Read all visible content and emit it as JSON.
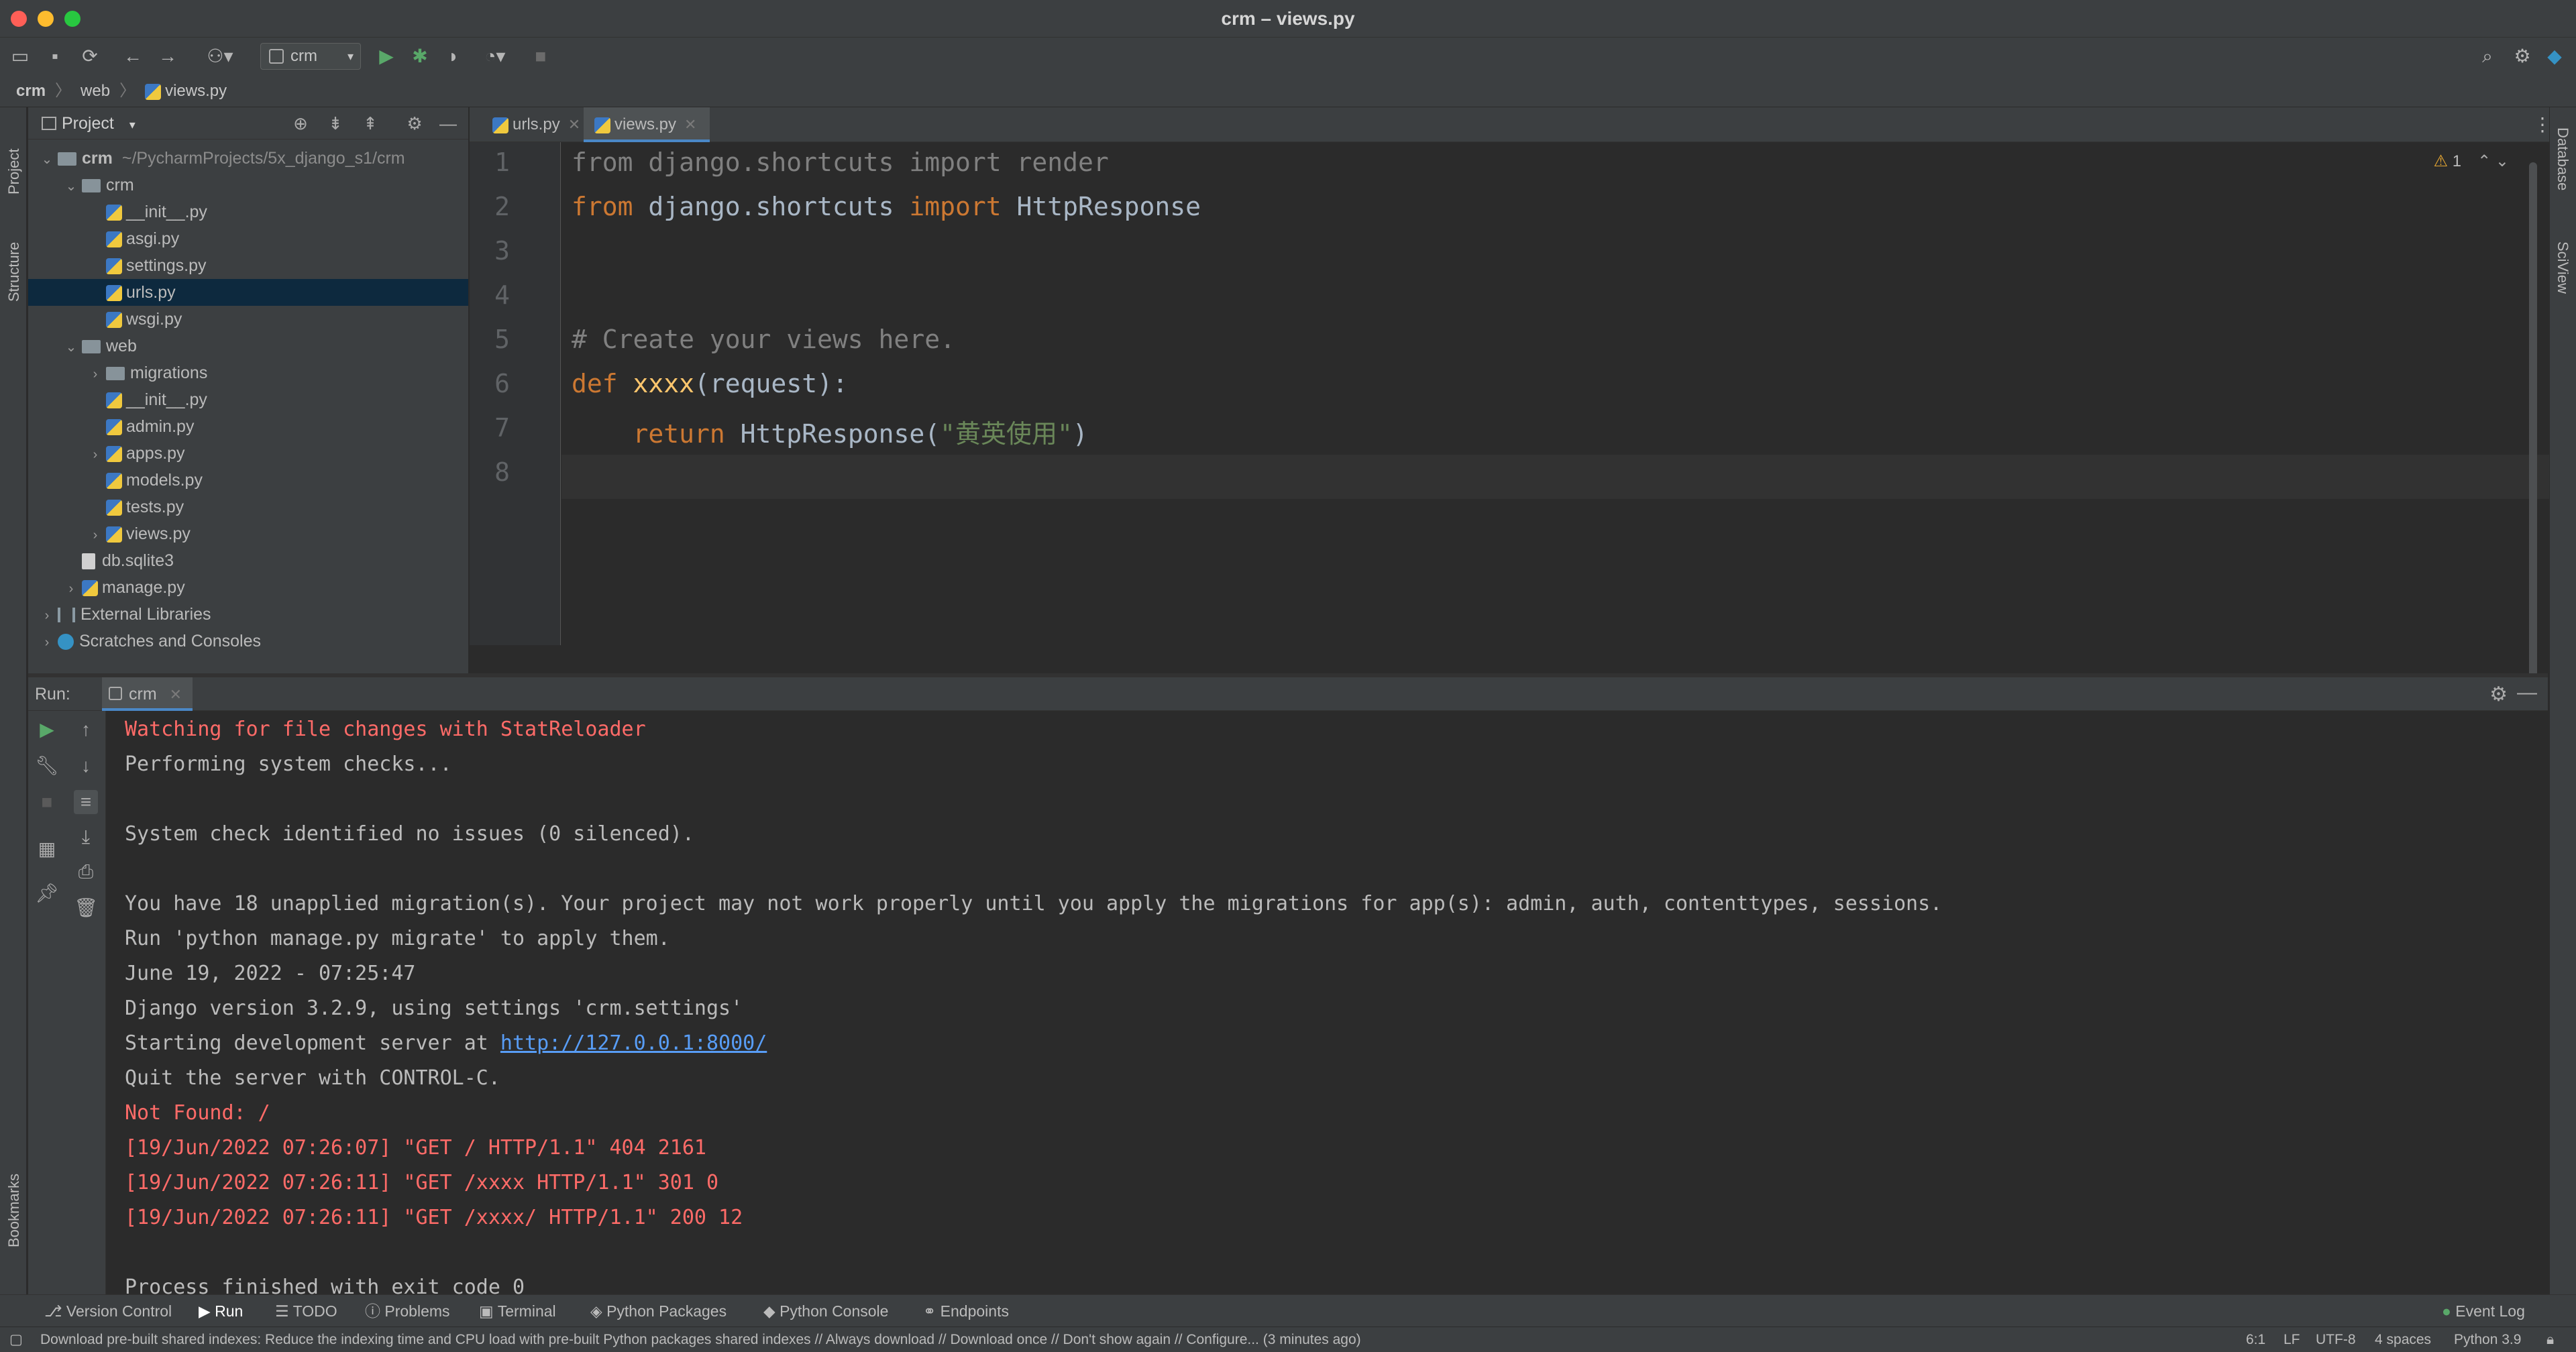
{
  "window": {
    "title": "crm – views.py"
  },
  "toolbar": {
    "run_config": "crm"
  },
  "breadcrumb": [
    "crm",
    "web",
    "views.py"
  ],
  "left_strip": [
    "Project",
    "Structure",
    "Bookmarks"
  ],
  "right_strip": [
    "Database",
    "SciView"
  ],
  "project_panel": {
    "title": "Project",
    "tree": [
      {
        "label": "crm",
        "suffix": "~/PycharmProjects/5x_django_s1/crm",
        "depth": 0,
        "type": "folder",
        "expanded": true
      },
      {
        "label": "crm",
        "depth": 1,
        "type": "folder",
        "expanded": true
      },
      {
        "label": "__init__.py",
        "depth": 2,
        "type": "py"
      },
      {
        "label": "asgi.py",
        "depth": 2,
        "type": "py"
      },
      {
        "label": "settings.py",
        "depth": 2,
        "type": "py"
      },
      {
        "label": "urls.py",
        "depth": 2,
        "type": "py",
        "selected": true
      },
      {
        "label": "wsgi.py",
        "depth": 2,
        "type": "py"
      },
      {
        "label": "web",
        "depth": 1,
        "type": "folder",
        "expanded": true
      },
      {
        "label": "migrations",
        "depth": 2,
        "type": "folder",
        "collapsed": true
      },
      {
        "label": "__init__.py",
        "depth": 2,
        "type": "py"
      },
      {
        "label": "admin.py",
        "depth": 2,
        "type": "py"
      },
      {
        "label": "apps.py",
        "depth": 2,
        "type": "py",
        "collapsed": true
      },
      {
        "label": "models.py",
        "depth": 2,
        "type": "py"
      },
      {
        "label": "tests.py",
        "depth": 2,
        "type": "py"
      },
      {
        "label": "views.py",
        "depth": 2,
        "type": "py",
        "collapsed": true
      },
      {
        "label": "db.sqlite3",
        "depth": 1,
        "type": "db"
      },
      {
        "label": "manage.py",
        "depth": 1,
        "type": "py",
        "collapsed": true
      },
      {
        "label": "External Libraries",
        "depth": 0,
        "type": "lib",
        "collapsed": true
      },
      {
        "label": "Scratches and Consoles",
        "depth": 0,
        "type": "scratch",
        "collapsed": true
      }
    ]
  },
  "editor": {
    "tabs": [
      {
        "label": "urls.py",
        "active": false
      },
      {
        "label": "views.py",
        "active": true
      }
    ],
    "warnings": "1",
    "line_numbers": [
      "1",
      "2",
      "3",
      "4",
      "5",
      "6",
      "7",
      "8"
    ],
    "lines": [
      {
        "tokens": [
          {
            "t": "from",
            "c": "dim"
          },
          {
            "t": " django.shortcuts ",
            "c": "dim"
          },
          {
            "t": "import",
            "c": "dim"
          },
          {
            "t": " render",
            "c": "dim"
          }
        ]
      },
      {
        "tokens": [
          {
            "t": "from",
            "c": "kw"
          },
          {
            "t": " django.shortcuts ",
            "c": ""
          },
          {
            "t": "import",
            "c": "kw"
          },
          {
            "t": " HttpResponse",
            "c": ""
          }
        ]
      },
      {
        "tokens": []
      },
      {
        "tokens": []
      },
      {
        "tokens": [
          {
            "t": "# Create your views here.",
            "c": "cmt"
          }
        ]
      },
      {
        "tokens": [
          {
            "t": "def",
            "c": "kw"
          },
          {
            "t": " ",
            "c": ""
          },
          {
            "t": "xxxx",
            "c": "fn"
          },
          {
            "t": "(request):",
            "c": ""
          }
        ]
      },
      {
        "tokens": [
          {
            "t": "    ",
            "c": ""
          },
          {
            "t": "return",
            "c": "kw"
          },
          {
            "t": " HttpResponse(",
            "c": ""
          },
          {
            "t": "\"黄英使用\"",
            "c": "str"
          },
          {
            "t": ")",
            "c": ""
          }
        ]
      },
      {
        "tokens": []
      }
    ]
  },
  "run_panel": {
    "label": "Run:",
    "tab": "crm",
    "output": [
      {
        "text": "Watching for file changes with StatReloader",
        "red": true
      },
      {
        "text": "Performing system checks...",
        "red": false
      },
      {
        "text": "",
        "red": false
      },
      {
        "text": "System check identified no issues (0 silenced).",
        "red": false
      },
      {
        "text": "",
        "red": false
      },
      {
        "text": "You have 18 unapplied migration(s). Your project may not work properly until you apply the migrations for app(s): admin, auth, contenttypes, sessions.",
        "red": false
      },
      {
        "text": "Run 'python manage.py migrate' to apply them.",
        "red": false
      },
      {
        "text": "June 19, 2022 - 07:25:47",
        "red": false
      },
      {
        "text": "Django version 3.2.9, using settings 'crm.settings'",
        "red": false
      },
      {
        "text": "Starting development server at ",
        "link": "http://127.0.0.1:8000/",
        "red": false
      },
      {
        "text": "Quit the server with CONTROL-C.",
        "red": false
      },
      {
        "text": "Not Found: /",
        "red": true
      },
      {
        "text": "[19/Jun/2022 07:26:07] \"GET / HTTP/1.1\" 404 2161",
        "red": true
      },
      {
        "text": "[19/Jun/2022 07:26:11] \"GET /xxxx HTTP/1.1\" 301 0",
        "red": true
      },
      {
        "text": "[19/Jun/2022 07:26:11] \"GET /xxxx/ HTTP/1.1\" 200 12",
        "red": true
      },
      {
        "text": "",
        "red": false
      },
      {
        "text": "Process finished with exit code 0",
        "red": false
      }
    ]
  },
  "bottom_tools": {
    "items": [
      "Version Control",
      "Run",
      "TODO",
      "Problems",
      "Terminal",
      "Python Packages",
      "Python Console",
      "Endpoints"
    ],
    "event_log": "Event Log"
  },
  "status": {
    "message": "Download pre-built shared indexes: Reduce the indexing time and CPU load with pre-built Python packages shared indexes // Always download // Download once // Don't show again // Configure... (3 minutes ago)",
    "position": "6:1",
    "line_sep": "LF",
    "encoding": "UTF-8",
    "indent": "4 spaces",
    "interpreter": "Python 3.9"
  },
  "colors": {
    "accent": "#4a88c7",
    "keyword": "#cc7832",
    "function": "#ffc66d",
    "string": "#6a8759",
    "error": "#ff6b68",
    "link": "#589df6"
  }
}
